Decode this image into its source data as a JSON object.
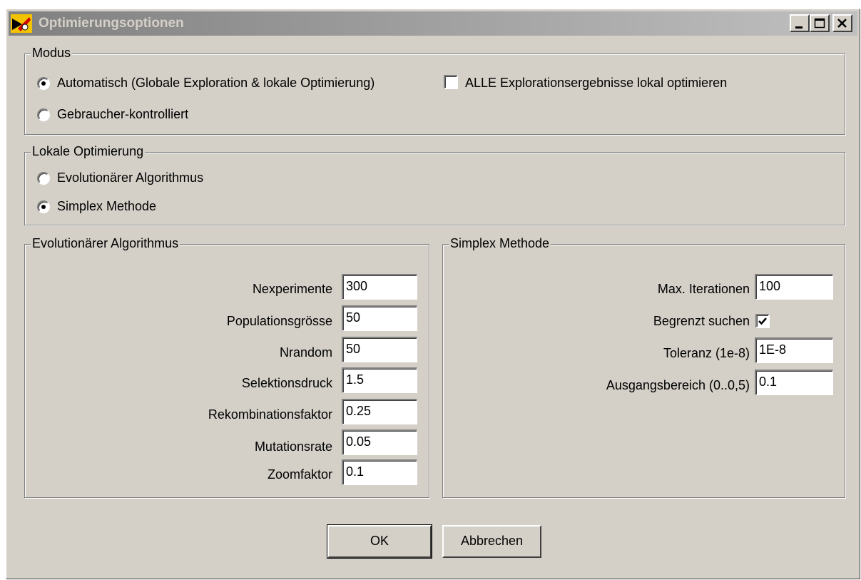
{
  "window": {
    "title": "Optimierungsoptionen",
    "minimize_icon": "minimize-icon",
    "maximize_icon": "maximize-icon",
    "close_icon": "close-icon"
  },
  "modus": {
    "legend": "Modus",
    "options": [
      {
        "label": "Automatisch (Globale Exploration & lokale Optimierung)",
        "selected": true
      },
      {
        "label": "Gebraucher-kontrolliert",
        "selected": false
      }
    ],
    "checkbox": {
      "label": "ALLE Explorationsergebnisse lokal optimieren",
      "checked": false
    }
  },
  "lokal": {
    "legend": "Lokale Optimierung",
    "options": [
      {
        "label": "Evolutionärer Algorithmus",
        "selected": false
      },
      {
        "label": "Simplex Methode",
        "selected": true
      }
    ]
  },
  "evo": {
    "legend": "Evolutionärer Algorithmus",
    "fields": [
      {
        "label": "Nexperimente",
        "value": "300"
      },
      {
        "label": "Populationsgrösse",
        "value": "50"
      },
      {
        "label": "Nrandom",
        "value": "50"
      },
      {
        "label": "Selektionsdruck",
        "value": "1.5"
      },
      {
        "label": "Rekombinationsfaktor",
        "value": "0.25"
      },
      {
        "label": "Mutationsrate",
        "value": "0.05"
      },
      {
        "label": "Zoomfaktor",
        "value": "0.1"
      }
    ]
  },
  "simplex": {
    "legend": "Simplex Methode",
    "max_iter": {
      "label": "Max. Iterationen",
      "value": "100"
    },
    "begrenzt": {
      "label": "Begrenzt suchen",
      "checked": true
    },
    "toleranz": {
      "label": "Toleranz (1e-8)",
      "value": "1E-8"
    },
    "ausgang": {
      "label": "Ausgangsbereich (0..0,5)",
      "value": "0.1"
    }
  },
  "buttons": {
    "ok": "OK",
    "cancel": "Abbrechen"
  }
}
